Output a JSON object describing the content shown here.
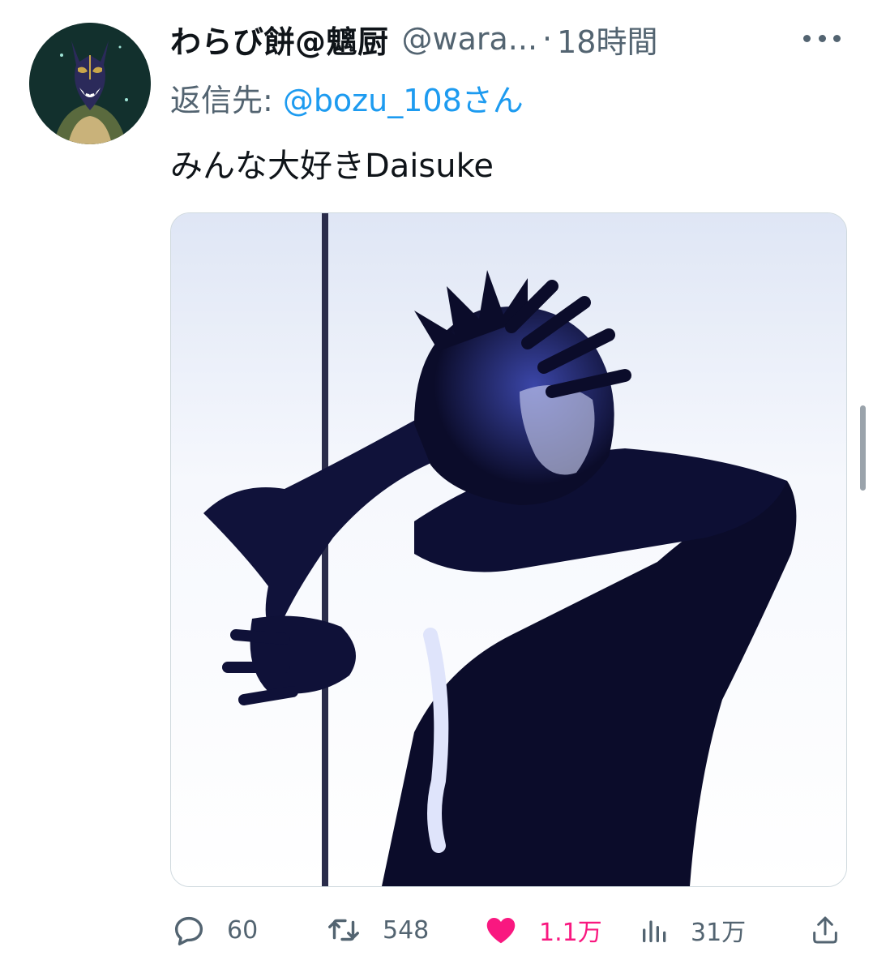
{
  "tweet": {
    "display_name": "わらび餅@魑厨",
    "handle": "@wara...",
    "separator": "·",
    "time": "18時間",
    "reply_label": "返信先:",
    "reply_handle": "@bozu_108さん",
    "text": "みんな大好きDaisuke"
  },
  "actions": {
    "replies": "60",
    "retweets": "548",
    "likes": "1.1万",
    "views": "31万"
  },
  "colors": {
    "text": "#0f1419",
    "secondary": "#536471",
    "link": "#1d9bf0",
    "like": "#f91880"
  },
  "icons": {
    "more": "more-horizontal-icon",
    "reply": "speech-bubble-icon",
    "retweet": "retweet-icon",
    "like": "heart-filled-icon",
    "views": "bar-chart-icon",
    "share": "share-upload-icon"
  }
}
